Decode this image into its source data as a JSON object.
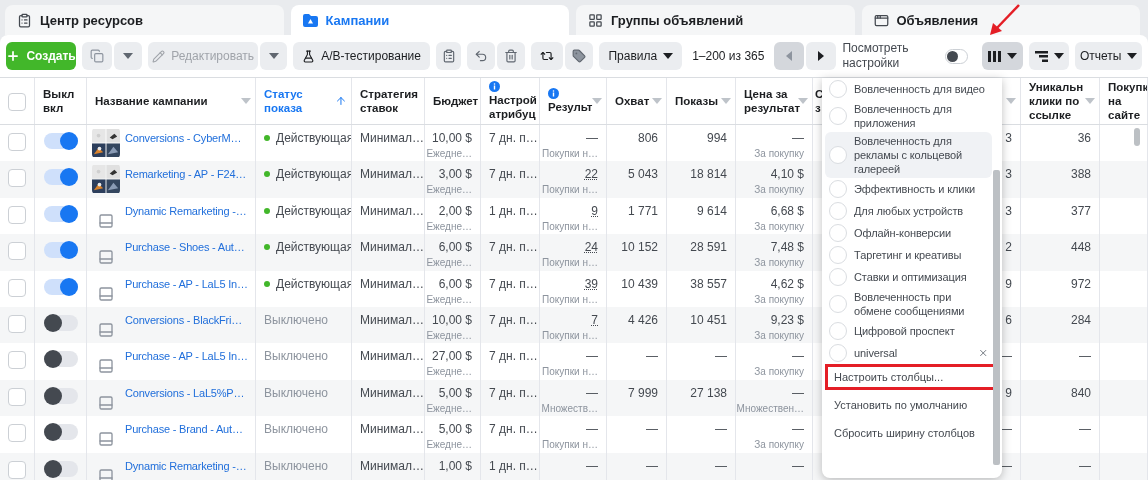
{
  "tabs": [
    {
      "label": "Центр ресурсов",
      "selected": false
    },
    {
      "label": "Кампании",
      "selected": true
    },
    {
      "label": "Группы объявлений",
      "selected": false
    },
    {
      "label": "Объявления",
      "selected": false
    }
  ],
  "toolbar": {
    "create": "Создать",
    "edit": {
      "label": "Редактировать",
      "disabled": true
    },
    "ab_test": "A/B-тестирование",
    "rules": "Правила",
    "pagination": "1–200 из 365",
    "view_settings": {
      "label": "Посмотреть настройки",
      "on": false
    },
    "columns_button": {
      "pressed": true
    },
    "reports": "Отчеты"
  },
  "table": {
    "select_all_checked": false,
    "columns": [
      {
        "label": "Выкл вкл",
        "caret": false,
        "sorted": false,
        "info": false
      },
      {
        "label": "Название кампании",
        "caret": true,
        "sorted": false,
        "info": false
      },
      {
        "label": "Статус показа",
        "caret": false,
        "sorted": true,
        "info": false
      },
      {
        "label": "Стратегия ставок",
        "caret": false,
        "sorted": false,
        "info": false
      },
      {
        "label": "Бюджет",
        "caret": false,
        "sorted": false,
        "info": false
      },
      {
        "label": "Настрой атрибуц",
        "caret": false,
        "sorted": false,
        "info": true
      },
      {
        "label": "Результ",
        "caret": true,
        "sorted": false,
        "info": true
      },
      {
        "label": "Охват",
        "caret": true,
        "sorted": false,
        "info": false
      },
      {
        "label": "Показы",
        "caret": true,
        "sorted": false,
        "info": false
      },
      {
        "label": "Цена за результат",
        "caret": true,
        "sorted": false,
        "info": false
      },
      {
        "label": "С з",
        "caret": true,
        "sorted": false,
        "info": false
      },
      {
        "label": "Уникальн клики по ссылке",
        "caret": true,
        "sorted": false,
        "info": false
      },
      {
        "label": "Покупк на сайте",
        "caret": false,
        "sorted": false,
        "info": false
      }
    ],
    "rows": [
      {
        "checked": false,
        "on": true,
        "kind": "picture",
        "name": "Conversions - CyberM…",
        "status": {
          "text": "Действующая",
          "active": true
        },
        "strategy": "Минимал…",
        "budget": {
          "value": "10,00 $",
          "note": "Ежедне…"
        },
        "attribution": "7 дн. п…",
        "results": {
          "value": "—",
          "linked": false,
          "note": "Покупки н…"
        },
        "reach": "806",
        "impressions": "994",
        "cost": {
          "value": "—",
          "note": "За покупку"
        },
        "column_12": "3",
        "unique_clicks": "36"
      },
      {
        "checked": false,
        "on": true,
        "kind": "picture",
        "name": "Remarketing - AP - F24…",
        "status": {
          "text": "Действующая",
          "active": true
        },
        "strategy": "Минимал…",
        "budget": {
          "value": "3,00 $",
          "note": "Ежедне…"
        },
        "attribution": "7 дн. п…",
        "results": {
          "value": "22",
          "linked": true,
          "note": "Покупки н…"
        },
        "reach": "5 043",
        "impressions": "18 814",
        "cost": {
          "value": "4,10 $",
          "note": "За покупку"
        },
        "column_12": "3",
        "unique_clicks": "388"
      },
      {
        "checked": false,
        "on": true,
        "kind": "placeholder",
        "name": "Dynamic Remarketing -…",
        "status": {
          "text": "Действующая",
          "active": true
        },
        "strategy": "Минимал…",
        "budget": {
          "value": "2,00 $",
          "note": "Ежедне…"
        },
        "attribution": "1 дн. п…",
        "results": {
          "value": "9",
          "linked": true,
          "note": "Покупки н…"
        },
        "reach": "1 771",
        "impressions": "9 614",
        "cost": {
          "value": "6,68 $",
          "note": "За покупку"
        },
        "column_12": "3",
        "unique_clicks": "377"
      },
      {
        "checked": false,
        "on": true,
        "kind": "placeholder",
        "name": "Purchase - Shoes - Aut…",
        "status": {
          "text": "Действующая",
          "active": true
        },
        "strategy": "Минимал…",
        "budget": {
          "value": "6,00 $",
          "note": "Ежедне…"
        },
        "attribution": "7 дн. п…",
        "results": {
          "value": "24",
          "linked": true,
          "note": "Покупки н…"
        },
        "reach": "10 152",
        "impressions": "28 591",
        "cost": {
          "value": "7,48 $",
          "note": "За покупку"
        },
        "column_12": "2",
        "unique_clicks": "448"
      },
      {
        "checked": false,
        "on": true,
        "kind": "placeholder",
        "name": "Purchase - AP - LaL5 In…",
        "status": {
          "text": "Действующая",
          "active": true
        },
        "strategy": "Минимал…",
        "budget": {
          "value": "6,00 $",
          "note": "Ежедне…"
        },
        "attribution": "7 дн. п…",
        "results": {
          "value": "39",
          "linked": true,
          "note": "Покупки н…"
        },
        "reach": "10 439",
        "impressions": "38 557",
        "cost": {
          "value": "4,62 $",
          "note": "За покупку"
        },
        "column_12": "9",
        "unique_clicks": "972"
      },
      {
        "checked": false,
        "on": false,
        "kind": "placeholder",
        "name": "Conversions - BlackFri…",
        "status": {
          "text": "Выключено",
          "active": false
        },
        "strategy": "Минимал…",
        "budget": {
          "value": "10,00 $",
          "note": "Ежедне…"
        },
        "attribution": "7 дн. п…",
        "results": {
          "value": "7",
          "linked": true,
          "note": "Покупки н…"
        },
        "reach": "4 426",
        "impressions": "10 451",
        "cost": {
          "value": "9,23 $",
          "note": "За покупку"
        },
        "column_12": "6",
        "unique_clicks": "284"
      },
      {
        "checked": false,
        "on": false,
        "kind": "placeholder",
        "name": "Purchase - AP - LaL5 In…",
        "status": {
          "text": "Выключено",
          "active": false
        },
        "strategy": "Минимал…",
        "budget": {
          "value": "27,00 $",
          "note": "Ежедне…"
        },
        "attribution": "7 дн. п…",
        "results": {
          "value": "—",
          "linked": false,
          "note": "Покупки н…"
        },
        "reach": "—",
        "impressions": "—",
        "cost": {
          "value": "—",
          "note": "За покупку"
        },
        "column_12": "—",
        "unique_clicks": "—"
      },
      {
        "checked": false,
        "on": false,
        "kind": "placeholder",
        "name": "Conversions - LaL5%P…",
        "status": {
          "text": "Выключено",
          "active": false
        },
        "strategy": "Минимал…",
        "budget": {
          "value": "5,00 $",
          "note": "Ежедне…"
        },
        "attribution": "7 дн. п…",
        "results": {
          "value": "—",
          "linked": false,
          "note": "Множеств…"
        },
        "reach": "7 999",
        "impressions": "27 138",
        "cost": {
          "value": "—",
          "note": "Множествен…"
        },
        "column_12": "9",
        "unique_clicks": "840"
      },
      {
        "checked": false,
        "on": false,
        "kind": "placeholder",
        "name": "Purchase - Brand - Aut…",
        "status": {
          "text": "Выключено",
          "active": false
        },
        "strategy": "Минимал…",
        "budget": {
          "value": "5,00 $",
          "note": "Ежедне…"
        },
        "attribution": "7 дн. п…",
        "results": {
          "value": "—",
          "linked": false,
          "note": "Покупки н…"
        },
        "reach": "—",
        "impressions": "—",
        "cost": {
          "value": "—",
          "note": "За покупку"
        },
        "column_12": "—",
        "unique_clicks": "—"
      },
      {
        "checked": false,
        "on": false,
        "kind": "placeholder",
        "name": "Dynamic Remarketing -…",
        "status": {
          "text": "Выключено",
          "active": false
        },
        "strategy": "Минимал…",
        "budget": {
          "value": "1,00 $"
        },
        "attribution": "1 дн. п…",
        "results": {
          "value": "—",
          "linked": false
        },
        "reach": "—",
        "impressions": "—",
        "cost": {
          "value": "—"
        },
        "column_12": "—",
        "unique_clicks": "—"
      }
    ]
  },
  "columns_menu": {
    "open": true,
    "presets": [
      {
        "label": "Вовлеченность для видео",
        "selected": false,
        "hovered": false,
        "removable": false
      },
      {
        "label": "Вовлеченность для приложения",
        "selected": false,
        "hovered": false,
        "removable": false
      },
      {
        "label": "Вовлеченность для рекламы с кольцевой галереей",
        "selected": false,
        "hovered": true,
        "removable": false
      },
      {
        "label": "Эффективность и клики",
        "selected": false,
        "hovered": false,
        "removable": false
      },
      {
        "label": "Для любых устройств",
        "selected": false,
        "hovered": false,
        "removable": false
      },
      {
        "label": "Офлайн-конверсии",
        "selected": false,
        "hovered": false,
        "removable": false
      },
      {
        "label": "Таргетинг и креативы",
        "selected": false,
        "hovered": false,
        "removable": false
      },
      {
        "label": "Ставки и оптимизация",
        "selected": false,
        "hovered": false,
        "removable": false
      },
      {
        "label": "Вовлеченность при обмене сообщениями",
        "selected": false,
        "hovered": false,
        "removable": false
      },
      {
        "label": "Цифровой проспект",
        "selected": false,
        "hovered": false,
        "removable": false
      },
      {
        "label": "universal",
        "selected": false,
        "hovered": false,
        "removable": true
      }
    ],
    "actions": [
      {
        "label": "Настроить столбцы...",
        "outlined": true
      },
      {
        "label": "Установить по умолчанию",
        "outlined": false
      },
      {
        "label": "Сбросить ширину столбцов",
        "outlined": false
      }
    ]
  }
}
